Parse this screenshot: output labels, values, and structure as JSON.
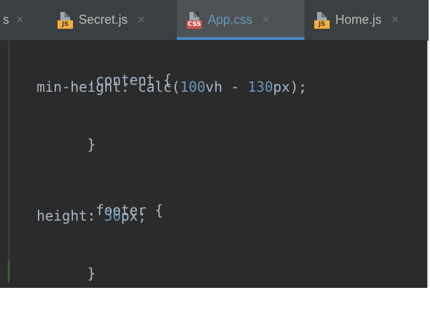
{
  "tabs": [
    {
      "label": "s",
      "icon": "",
      "active": false
    },
    {
      "label": "Secret.js",
      "icon": "js-file-icon",
      "badge": "JS",
      "active": false
    },
    {
      "label": "App.css",
      "icon": "css-file-icon",
      "badge": "CSS",
      "active": true
    },
    {
      "label": "Home.js",
      "icon": "js-file-icon",
      "badge": "JS",
      "active": false
    }
  ],
  "close_glyph": "×",
  "code": {
    "line1": ".content {",
    "line2_prop": "  min-height: calc(",
    "line2_n1": "100",
    "line2_mid": "vh - ",
    "line2_n2": "130",
    "line2_end": "px);",
    "line3": "}",
    "line5": ".footer {",
    "line6_prop": "  height: ",
    "line6_num": "50",
    "line6_end": "px;",
    "line7": "}"
  },
  "colors": {
    "editor_bg": "#2b2b2b",
    "tabbar_bg": "#3c3f41",
    "active_tab_text": "#6897bb",
    "active_tab_underline": "#4a88c7",
    "code_text": "#a9b7c6",
    "number": "#6897bb"
  }
}
